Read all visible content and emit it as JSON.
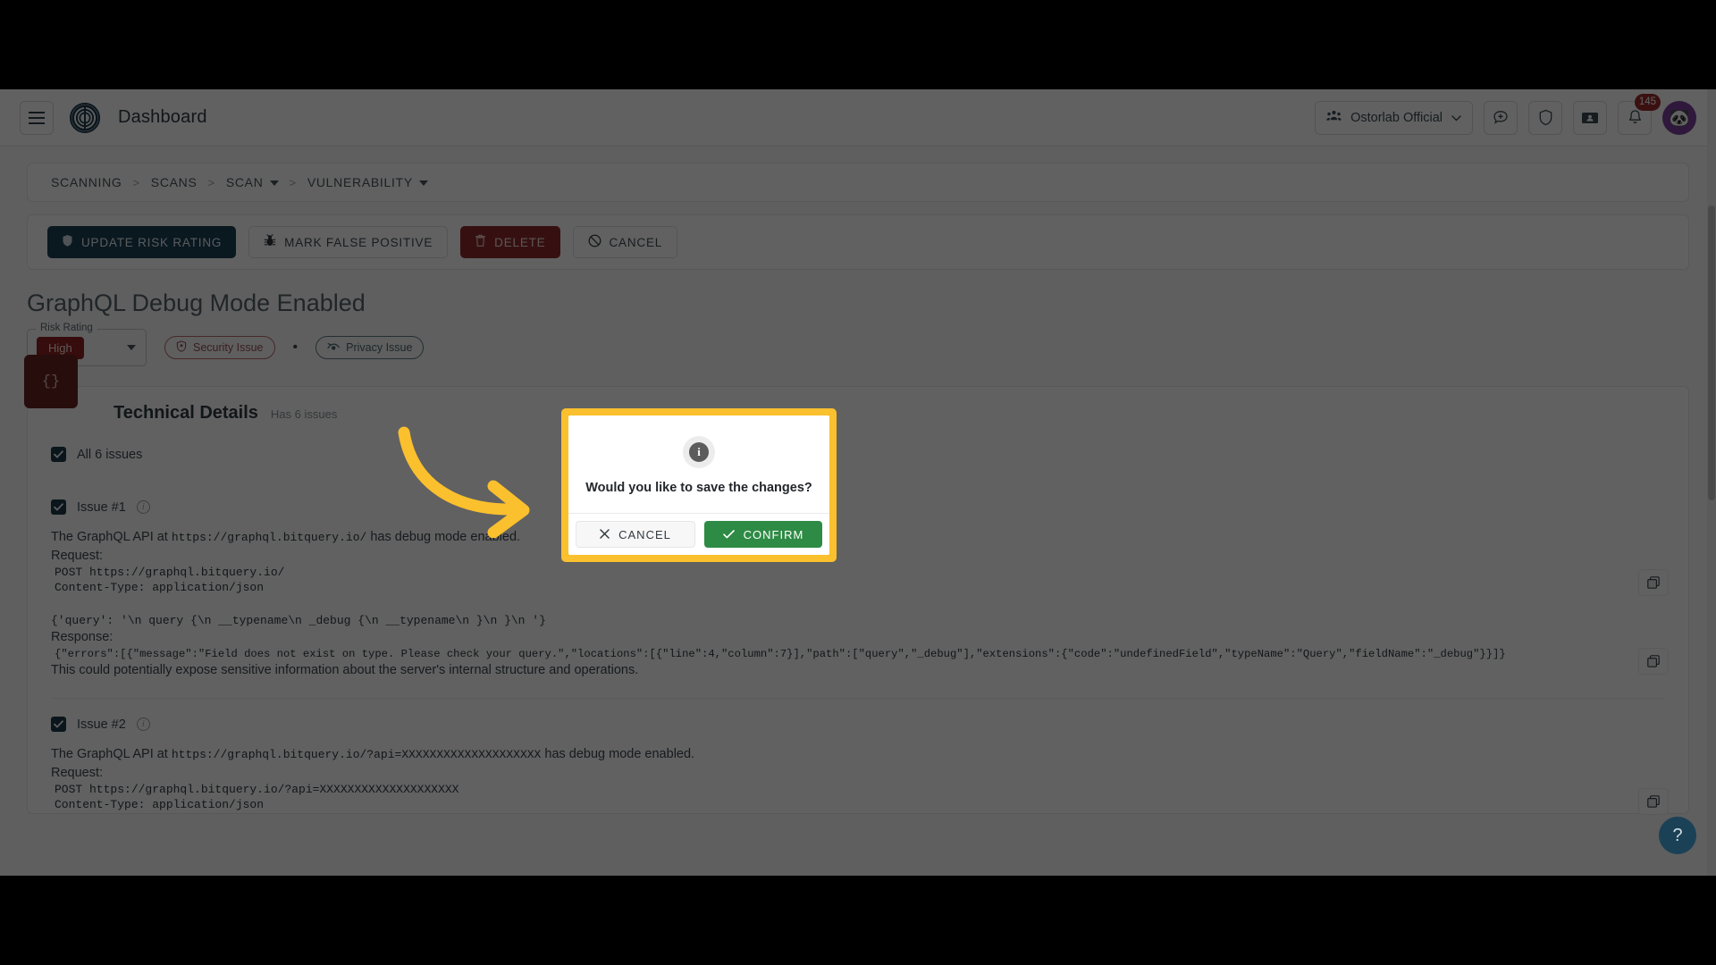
{
  "appbar": {
    "title": "Dashboard",
    "menu_icon": "hamburger-icon",
    "logo_icon": "ostorlab-logo-icon",
    "org_name": "Ostorlab Official",
    "org_icon": "group-people-icon",
    "icons": [
      {
        "name": "add-chat-icon",
        "label": ""
      },
      {
        "name": "shield-icon",
        "label": ""
      },
      {
        "name": "ticket-icon",
        "label": ""
      },
      {
        "name": "bell-icon",
        "label": ""
      }
    ],
    "notification_count": "145",
    "avatar_icon": "panda-avatar",
    "avatar_glyph": "🐼"
  },
  "breadcrumb": {
    "items": [
      {
        "label": "SCANNING",
        "has_caret": false
      },
      {
        "label": "SCANS",
        "has_caret": false
      },
      {
        "label": "SCAN",
        "has_caret": true
      },
      {
        "label": "VULNERABILITY",
        "has_caret": true
      }
    ],
    "separator": ">"
  },
  "actions": [
    {
      "label": "UPDATE RISK RATING",
      "icon": "shield-icon",
      "style": "primary"
    },
    {
      "label": "MARK FALSE POSITIVE",
      "icon": "bug-icon",
      "style": "ghost"
    },
    {
      "label": "DELETE",
      "icon": "trash-icon",
      "style": "danger"
    },
    {
      "label": "CANCEL",
      "icon": "block-icon",
      "style": "ghost"
    }
  ],
  "vulnerability": {
    "title": "GraphQL Debug Mode Enabled",
    "risk_rating_legend": "Risk Rating",
    "risk_rating_value": "High",
    "risk_color": "#8e2121",
    "tags": [
      {
        "label": "Security Issue",
        "icon": "shield-bug-icon"
      },
      {
        "label": "Privacy Issue",
        "icon": "privacy-eye-icon"
      }
    ],
    "tag_separator": "•"
  },
  "technical_details": {
    "icon_glyph": "{}",
    "icon_name": "code-braces-icon",
    "title": "Technical Details",
    "subtitle": "Has 6 issues",
    "select_all_label": "All 6 issues",
    "issues": [
      {
        "label": "Issue #1",
        "intro_prefix": "The GraphQL API at",
        "intro_url": "https://graphql.bitquery.io/",
        "intro_suffix": "has debug mode enabled.",
        "request_label": "Request:",
        "request_line1": "POST https://graphql.bitquery.io/",
        "request_line2": "Content-Type: application/json",
        "query_line": "{'query': '\\n    query {\\n        __typename\\n      _debug {\\n          __typename\\n      }\\n    }\\n    '}",
        "response_label": "Response:",
        "response_line": "{\"errors\":[{\"message\":\"Field does not exist on type. Please check your query.\",\"locations\":[{\"line\":4,\"column\":7}],\"path\":[\"query\",\"_debug\"],\"extensions\":{\"code\":\"undefinedField\",\"typeName\":\"Query\",\"fieldName\":\"_debug\"}}]}",
        "footer_note": "This could potentially expose sensitive information about the server's internal structure and operations.",
        "copy_label": "copy-icon"
      },
      {
        "label": "Issue #2",
        "intro_prefix": "The GraphQL API at",
        "intro_url": "https://graphql.bitquery.io/?api=XXXXXXXXXXXXXXXXXXXX",
        "intro_suffix": "has debug mode enabled.",
        "request_label": "Request:",
        "request_line1": "POST https://graphql.bitquery.io/?api=XXXXXXXXXXXXXXXXXXXX",
        "request_line2": "Content-Type: application/json",
        "copy_label": "copy-icon"
      }
    ]
  },
  "dialog": {
    "icon_name": "info-icon",
    "icon_glyph": "i",
    "message": "Would you like to save the changes?",
    "cancel_label": "CANCEL",
    "confirm_label": "CONFIRM",
    "cancel_icon": "close-x-icon",
    "confirm_icon": "check-icon",
    "highlight_color": "#fbc02d",
    "confirm_color": "#2e8b45"
  },
  "annotation": {
    "arrow_color": "#fbc02d",
    "arrow_name": "curved-arrow-annotation"
  },
  "help_fab": {
    "glyph": "?",
    "name": "help-button"
  }
}
